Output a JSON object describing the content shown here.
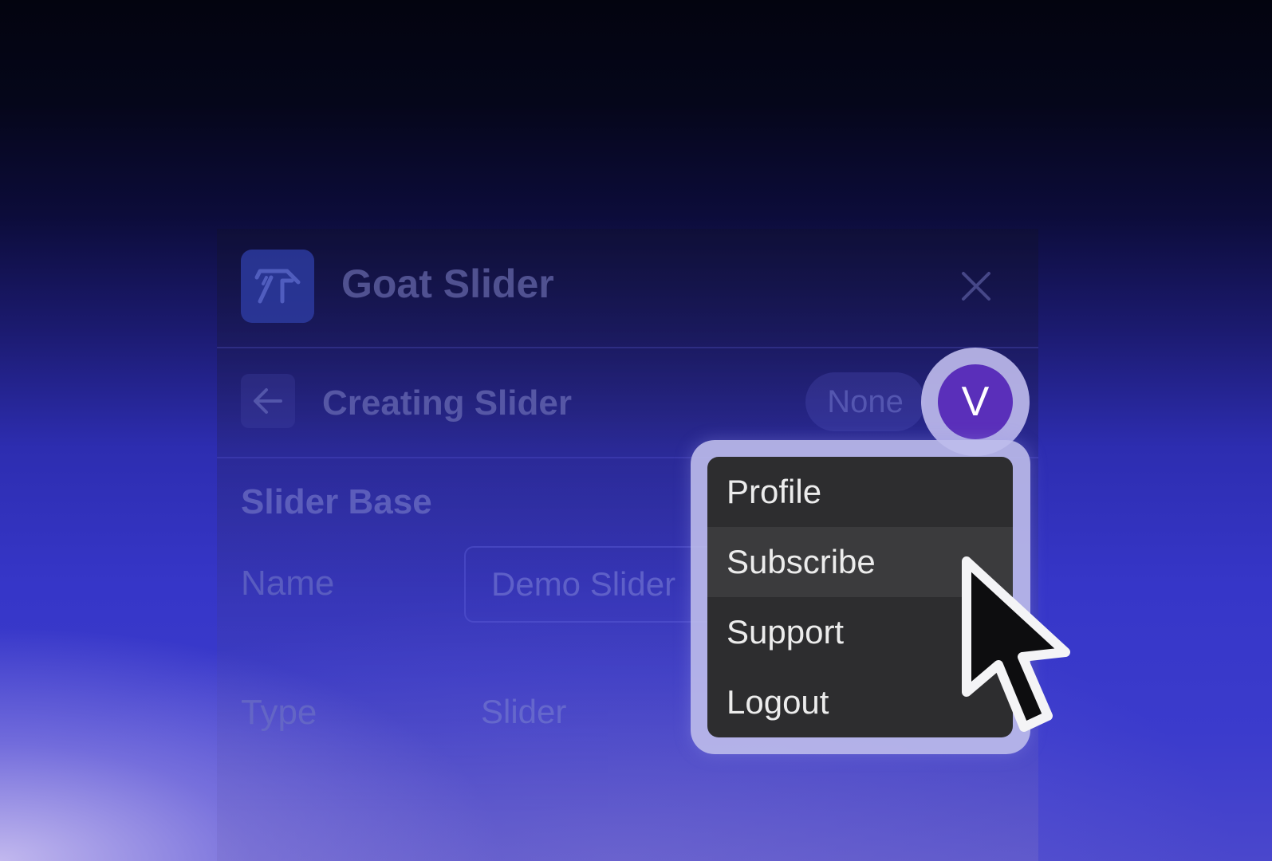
{
  "app": {
    "title": "Goat Slider",
    "logo_icon": "goat-logo-icon",
    "close_icon": "close-icon"
  },
  "subheader": {
    "back_icon": "arrow-left-icon",
    "title": "Creating Slider",
    "status_pill": "None"
  },
  "form": {
    "section_title": "Slider Base",
    "name_label": "Name",
    "name_value": "Demo Slider",
    "type_label": "Type",
    "type_value": "Slider"
  },
  "user": {
    "avatar_initial": "V"
  },
  "menu": {
    "items": [
      {
        "label": "Profile"
      },
      {
        "label": "Subscribe",
        "hovered": true
      },
      {
        "label": "Support"
      },
      {
        "label": "Logout"
      }
    ]
  },
  "colors": {
    "avatar": "#5a2fba",
    "menu_bg": "#2d2d2f",
    "menu_hover": "#3b3b3d",
    "accent_blue": "#3636c8"
  }
}
